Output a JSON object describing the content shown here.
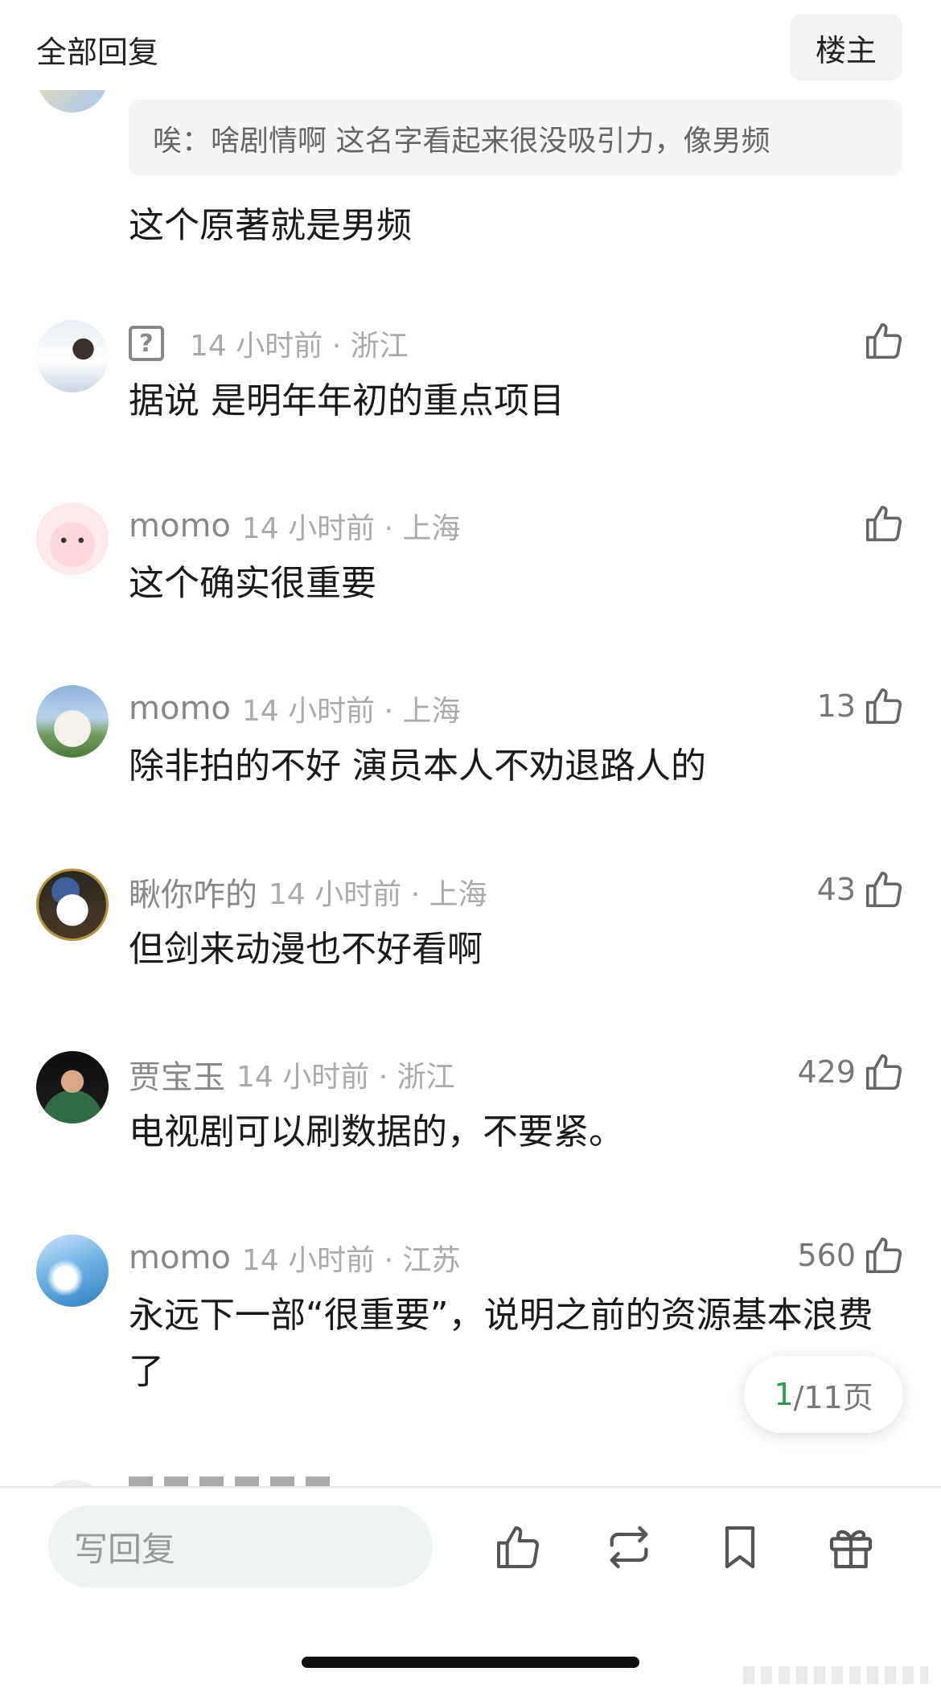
{
  "header": {
    "title": "全部回复",
    "op_label": "楼主"
  },
  "top_reply": {
    "quote": "唉：啥剧情啊 这名字看起来很没吸引力，像男频",
    "text": "这个原著就是男频"
  },
  "comments": [
    {
      "name": "",
      "time": "14 小时前 · 浙江",
      "likes": "",
      "text": "据说 是明年年初的重点项目",
      "avatar_icon": "photo-girl-snow"
    },
    {
      "name": "momo",
      "time": "14 小时前 · 上海",
      "likes": "",
      "text": "这个确实很重要",
      "avatar_icon": "pink-cartoon"
    },
    {
      "name": "momo",
      "time": "14 小时前 · 上海",
      "likes": "13",
      "text": "除非拍的不好 演员本人不劝退路人的",
      "avatar_icon": "white-cat"
    },
    {
      "name": "瞅你咋的",
      "time": "14 小时前 · 上海",
      "likes": "43",
      "text": "但剑来动漫也不好看啊",
      "avatar_icon": "hello-kitty-painting"
    },
    {
      "name": "贾宝玉",
      "time": "14 小时前 · 浙江",
      "likes": "429",
      "text": "电视剧可以刷数据的，不要紧。",
      "avatar_icon": "photo-person"
    },
    {
      "name": "momo",
      "time": "14 小时前 · 江苏",
      "likes": "560",
      "text": "永远下一部“很重要”，说明之前的资源基本浪费了",
      "avatar_icon": "blue-water"
    }
  ],
  "pagination": {
    "current": "1",
    "total": "/11页"
  },
  "bottom_bar": {
    "reply_placeholder": "写回复"
  },
  "colors": {
    "accent_green": "#2e9c4e",
    "meta_gray": "#aaaaaa"
  }
}
